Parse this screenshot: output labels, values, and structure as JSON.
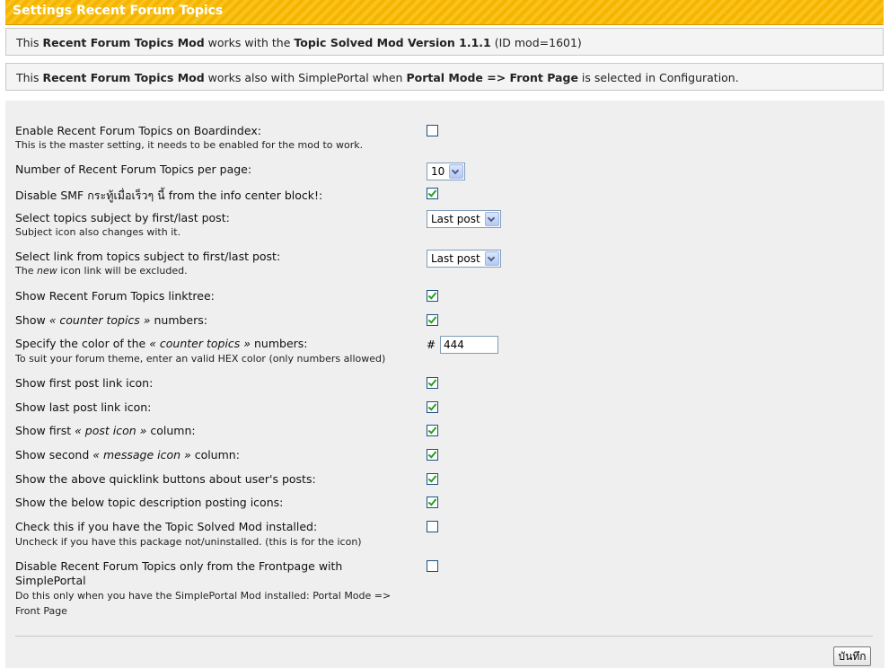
{
  "title": "Settings Recent Forum Topics",
  "info1": {
    "p1": "This ",
    "b1": "Recent Forum Topics Mod",
    "p2": " works with the ",
    "b2": "Topic Solved Mod Version 1.1.1",
    "p3": " (ID mod=1601)"
  },
  "info2": {
    "p1": "This ",
    "b1": "Recent Forum Topics Mod",
    "p2": " works also with SimplePortal when ",
    "b2": "Portal Mode => Front Page",
    "p3": " is selected in Configuration."
  },
  "settings": {
    "enable": {
      "label": "Enable Recent Forum Topics on Boardindex:",
      "sub": "This is the master setting, it needs to be enabled for the mod to work.",
      "checked": false
    },
    "per_page": {
      "label": "Number of Recent Forum Topics per page:",
      "value": "10"
    },
    "disable_smf": {
      "label": "Disable SMF กระทู้เมื่อเร็วๆ นี้ from the info center block!:",
      "checked": true
    },
    "subject_by": {
      "label": "Select topics subject by first/last post:",
      "sub": "Subject icon also changes with it.",
      "value": "Last post"
    },
    "subject_link": {
      "label": "Select link from topics subject to first/last post:",
      "sub_pre": "The ",
      "sub_em": "new",
      "sub_post": " icon link will be excluded.",
      "value": "Last post"
    },
    "linktree": {
      "label": "Show Recent Forum Topics linktree:",
      "checked": true
    },
    "counter": {
      "pre": "Show ",
      "em": "« counter topics »",
      "post": " numbers:",
      "checked": true
    },
    "color": {
      "pre": "Specify the color of the ",
      "em": "« counter topics »",
      "post": " numbers:",
      "sub": "To suit your forum theme, enter an valid HEX color (only numbers allowed)",
      "hash": "#",
      "value": "444"
    },
    "first_icon": {
      "label": "Show first post link icon:",
      "checked": true
    },
    "last_icon": {
      "label": "Show last post link icon:",
      "checked": true
    },
    "post_icon_col": {
      "pre": "Show first ",
      "em": "« post icon »",
      "post": " column:",
      "checked": true
    },
    "message_icon_col": {
      "pre": "Show second ",
      "em": "« message icon »",
      "post": " column:",
      "checked": true
    },
    "quicklink": {
      "label": "Show the above quicklink buttons about user's posts:",
      "checked": true
    },
    "posting_icons": {
      "label": "Show the below topic description posting icons:",
      "checked": true
    },
    "topic_solved": {
      "label": "Check this if you have the Topic Solved Mod installed:",
      "sub": "Uncheck if you have this package not/uninstalled. (this is for the icon)",
      "checked": false
    },
    "frontpage": {
      "label1": "Disable Recent Forum Topics only from the Frontpage with",
      "label2": "SimplePortal",
      "sub1": "Do this only when you have the SimplePortal Mod installed: Portal Mode =>",
      "sub2": "Front Page",
      "checked": false
    }
  },
  "save_label": "บันทึก"
}
